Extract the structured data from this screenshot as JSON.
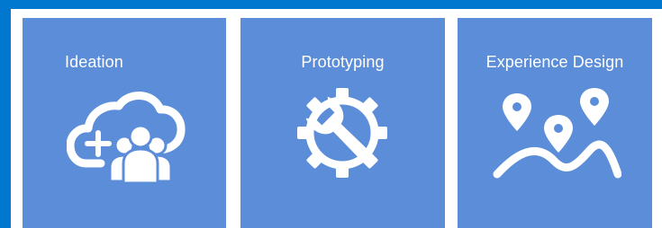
{
  "tiles": [
    {
      "label": "Ideation",
      "icon": "cloud-people-icon"
    },
    {
      "label": "Prototyping",
      "icon": "gear-wrench-icon"
    },
    {
      "label": "Experience Design",
      "icon": "map-pins-icon"
    }
  ],
  "colors": {
    "frame": "#0078d0",
    "tile": "#5b8dd9",
    "text": "#ffffff"
  }
}
